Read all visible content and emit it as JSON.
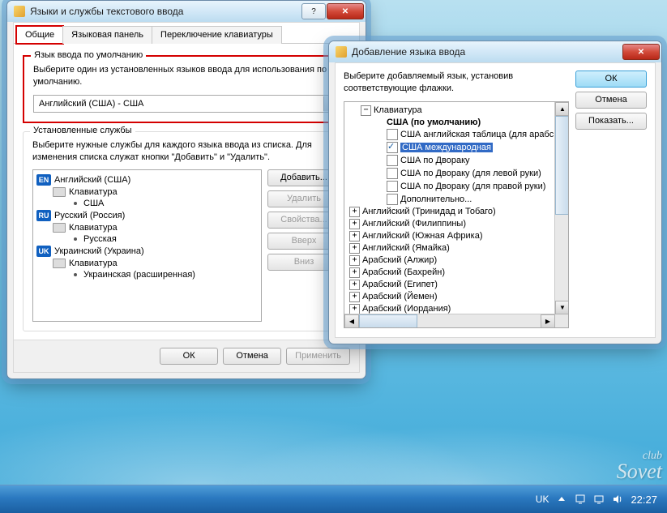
{
  "w1": {
    "title": "Языки и службы текстового ввода",
    "tabs": [
      "Общие",
      "Языковая панель",
      "Переключение клавиатуры"
    ],
    "grpDefault": {
      "title": "Язык ввода по умолчанию",
      "hint": "Выберите один из установленных языков ввода для использования по умолчанию.",
      "value": "Английский (США) - США"
    },
    "grpServices": {
      "title": "Установленные службы",
      "hint": "Выберите нужные службы для каждого языка ввода из списка. Для изменения списка служат кнопки \"Добавить\" и \"Удалить\".",
      "langs": [
        {
          "badge": "EN",
          "badgeCls": "badge-en",
          "name": "Английский (США)",
          "kbd": "Клавиатура",
          "layouts": [
            "США"
          ]
        },
        {
          "badge": "RU",
          "badgeCls": "badge-ru",
          "name": "Русский (Россия)",
          "kbd": "Клавиатура",
          "layouts": [
            "Русская"
          ]
        },
        {
          "badge": "UK",
          "badgeCls": "badge-uk",
          "name": "Украинский (Украина)",
          "kbd": "Клавиатура",
          "layouts": [
            "Украинская (расширенная)"
          ]
        }
      ],
      "btns": {
        "add": "Добавить...",
        "remove": "Удалить",
        "props": "Свойства...",
        "up": "Вверх",
        "down": "Вниз"
      }
    },
    "bottom": {
      "ok": "ОК",
      "cancel": "Отмена",
      "apply": "Применить"
    }
  },
  "w2": {
    "title": "Добавление языка ввода",
    "hint": "Выберите добавляемый язык, установив соответствующие флажки.",
    "btns": {
      "ok": "ОК",
      "cancel": "Отмена",
      "show": "Показать..."
    },
    "tree": {
      "root": "Клавиатура",
      "default": "США (по умолчанию)",
      "layouts": [
        {
          "label": "США английская таблица (для арабск",
          "checked": false
        },
        {
          "label": "США международная",
          "checked": true,
          "selected": true
        },
        {
          "label": "США по Двораку",
          "checked": false
        },
        {
          "label": "США по Двораку (для левой руки)",
          "checked": false
        },
        {
          "label": "США по Двораку (для правой руки)",
          "checked": false
        },
        {
          "label": "Дополнительно...",
          "checked": false
        }
      ],
      "siblings": [
        "Английский (Тринидад и Тобаго)",
        "Английский (Филиппины)",
        "Английский (Южная Африка)",
        "Английский (Ямайка)",
        "Арабский (Алжир)",
        "Арабский (Бахрейн)",
        "Арабский (Египет)",
        "Арабский (Йемен)",
        "Арабский (Иордания)"
      ]
    }
  },
  "taskbar": {
    "lang": "UK",
    "time": "22:27"
  }
}
